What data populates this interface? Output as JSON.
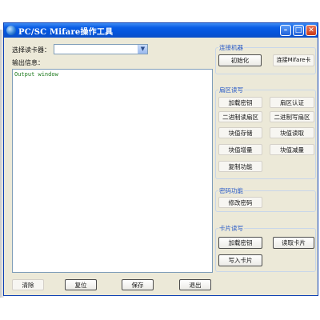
{
  "window": {
    "title": "PC/SC Mifare操作工具"
  },
  "reader": {
    "label": "选择读卡器：",
    "value": ""
  },
  "output": {
    "label": "输出信息：",
    "text": "Output window"
  },
  "bottom_buttons": {
    "clear": "清除",
    "reset": "复位",
    "save": "保存",
    "exit": "退出"
  },
  "groups": {
    "connect": {
      "title": "连接机器",
      "init": "初始化",
      "connect_mifare": "连接Mifare卡"
    },
    "sector": {
      "title": "扇区读写",
      "load_key": "加载密钥",
      "sector_auth": "扇区认证",
      "binary_read": "二进制读扇区",
      "binary_write": "二进制写扇区",
      "value_store": "块值存储",
      "value_read": "块值读取",
      "value_increment": "块值增量",
      "value_decrement": "块值减量",
      "copy": "复制功能"
    },
    "password": {
      "title": "密码功能",
      "change": "修改密码"
    },
    "card": {
      "title": "卡片读写",
      "load_key": "加载密钥",
      "read_card": "读取卡片",
      "write_card": "写入卡片"
    }
  },
  "colors": {
    "titlebar": "#0554d9",
    "window_bg": "#ece9d8",
    "group_title": "#2457c7",
    "output_text": "#1d7a1d"
  }
}
